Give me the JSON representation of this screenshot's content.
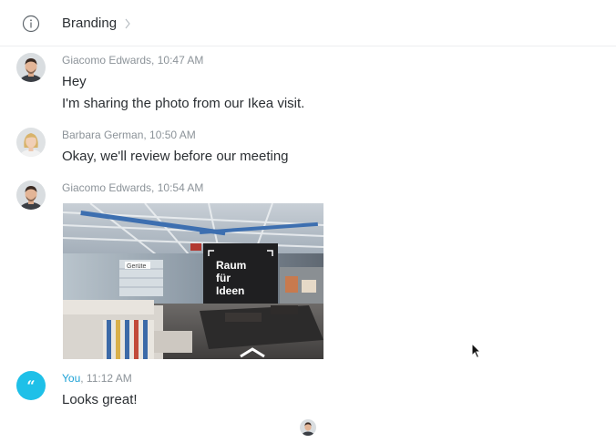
{
  "header": {
    "info_icon": "info-circle-icon",
    "breadcrumb": "Branding",
    "chevron_icon": "chevron-right-icon"
  },
  "messages": [
    {
      "author": "Giacomo Edwards",
      "time": "10:47 AM",
      "lines": [
        "Hey",
        "I'm sharing the photo from our Ikea visit."
      ]
    },
    {
      "author": "Barbara German",
      "time": "10:50 AM",
      "lines": [
        "Okay, we'll review before our meeting"
      ]
    },
    {
      "author": "Giacomo Edwards",
      "time": "10:54 AM",
      "photo_sign_lines": [
        "Raum",
        "für",
        "Ideen"
      ],
      "photo_small_signs": [
        "Gerüte"
      ]
    },
    {
      "author": "You",
      "time": "11:12 AM",
      "avatar_glyph": "“",
      "lines": [
        "Looks great!"
      ]
    }
  ],
  "colors": {
    "you_accent": "#1ea2d6",
    "you_avatar_bg": "#1ec0e8",
    "meta_text": "#8c9399",
    "body_text": "#2b2f33"
  }
}
